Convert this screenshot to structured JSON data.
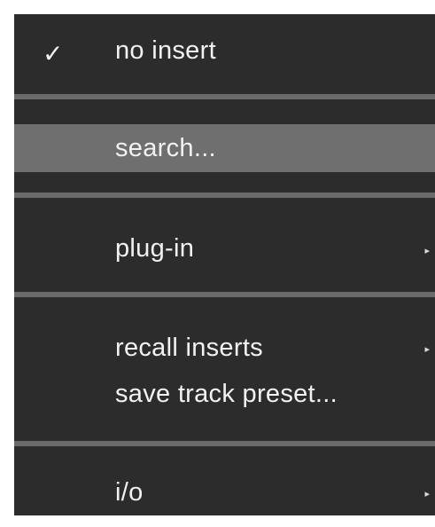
{
  "menu": {
    "items": [
      {
        "label": "no insert",
        "checked": true,
        "check_glyph": "✓",
        "submenu": false
      },
      {
        "label": "search...",
        "highlighted": true,
        "submenu": false
      },
      {
        "label": "plug-in",
        "submenu": true,
        "arrow_glyph": "▸"
      },
      {
        "label": "recall inserts",
        "submenu": true,
        "arrow_glyph": "▸"
      },
      {
        "label": "save track preset...",
        "submenu": false
      },
      {
        "label": "i/o",
        "submenu": true,
        "arrow_glyph": "▸"
      }
    ]
  },
  "colors": {
    "menu_background": "#2c2c2c",
    "separator": "#6a6a6a",
    "highlight": "#6f6f6f",
    "text": "#f2f2f2"
  }
}
